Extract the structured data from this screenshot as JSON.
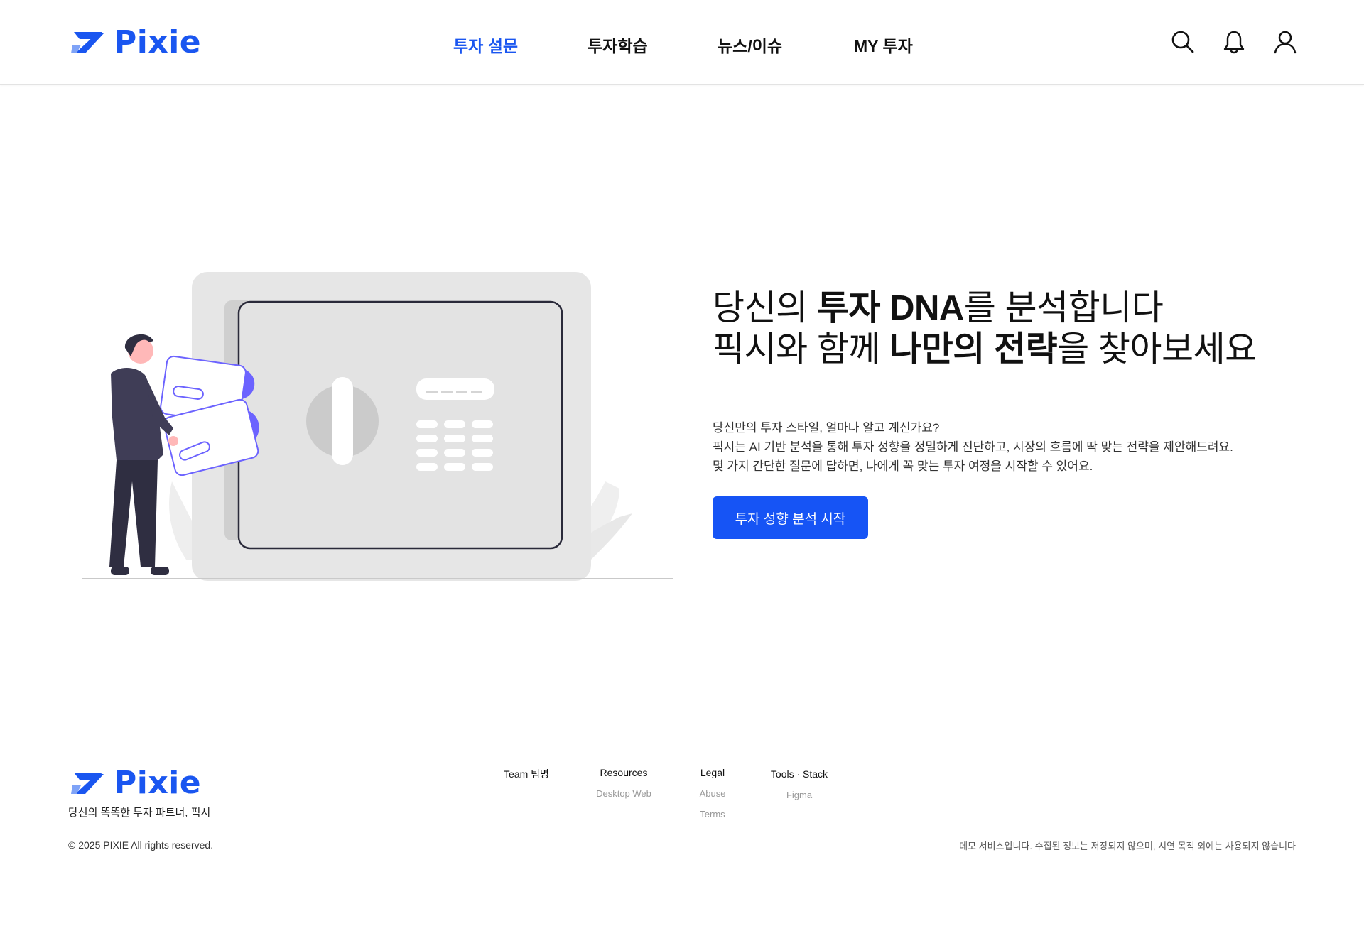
{
  "brand": {
    "name": "Pixie",
    "color": "#1a56f0"
  },
  "nav": {
    "items": [
      {
        "label": "투자 설문",
        "active": true
      },
      {
        "label": "투자학습",
        "active": false
      },
      {
        "label": "뉴스/이슈",
        "active": false
      },
      {
        "label": "MY 투자",
        "active": false
      }
    ],
    "icons": [
      "search-icon",
      "bell-icon",
      "user-icon"
    ]
  },
  "hero": {
    "title_line1_pre": "당신의 ",
    "title_line1_bold": "투자 DNA",
    "title_line1_post": "를 분석합니다",
    "title_line2_pre": "픽시와 함께 ",
    "title_line2_bold": "나만의 전략",
    "title_line2_post": "을 찾아보세요",
    "desc_lines": [
      "당신만의 투자 스타일, 얼마나 알고 계신가요?",
      "픽시는 AI 기반 분석을 통해 투자 성향을 정밀하게 진단하고, 시장의 흐름에 딱 맞는 전략을 제안해드려요.",
      "몇 가지 간단한 질문에 답하면, 나에게 꼭 맞는 투자 여정을 시작할 수 있어요."
    ],
    "cta_label": "투자 성향 분석 시작",
    "cta_color": "#1654f5"
  },
  "footer": {
    "tagline": "당신의 똑똑한 투자 파트너, 픽시",
    "columns": [
      {
        "heading": "Team 팀명",
        "links": []
      },
      {
        "heading": "Resources",
        "links": [
          "Desktop Web"
        ]
      },
      {
        "heading": "Legal",
        "links": [
          "Abuse",
          "Terms"
        ]
      },
      {
        "heading": "Tools · Stack",
        "links": [
          "Figma"
        ]
      }
    ],
    "copyright": "© 2025 PIXIE All rights reserved.",
    "notice": "데모 서비스입니다. 수집된 정보는 저장되지 않으며, 시연 목적 외에는 사용되지 않습니다"
  }
}
